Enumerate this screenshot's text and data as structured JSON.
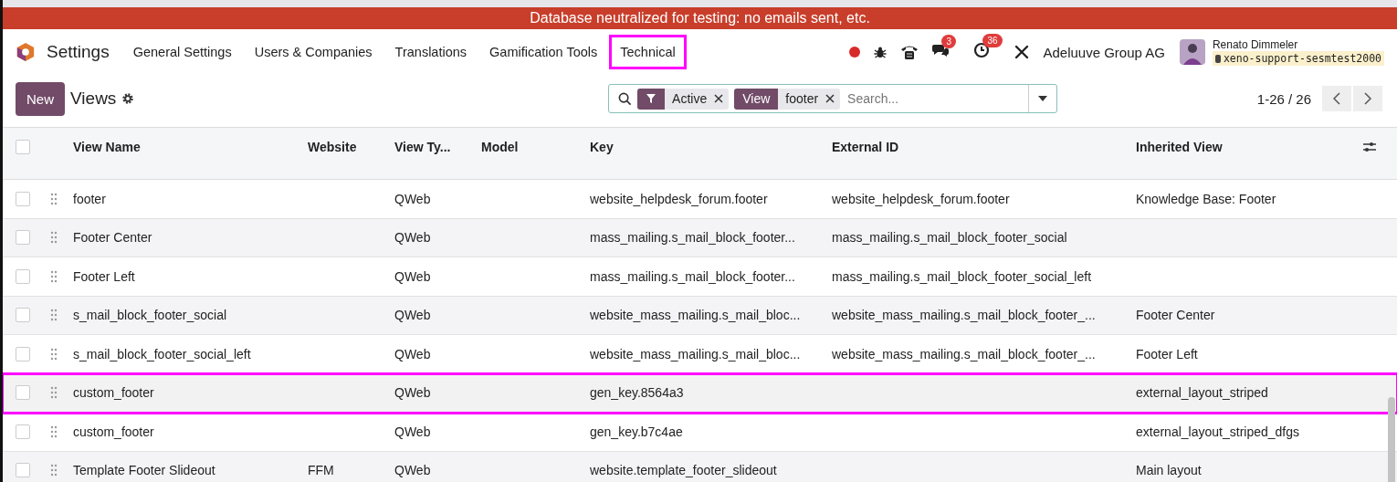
{
  "banner": {
    "text": "Database neutralized for testing: no emails sent, etc."
  },
  "nav": {
    "app": "Settings",
    "items": [
      {
        "label": "General Settings",
        "annotated": false
      },
      {
        "label": "Users & Companies",
        "annotated": false
      },
      {
        "label": "Translations",
        "annotated": false
      },
      {
        "label": "Gamification Tools",
        "annotated": false
      },
      {
        "label": "Technical",
        "annotated": true
      }
    ],
    "messages_badge": "3",
    "activities_badge": "36",
    "company": "Adeluuve Group AG",
    "user": "Renato Dimmeler",
    "database": "xeno-support-sesmtest2000"
  },
  "control_panel": {
    "new_button": "New",
    "title": "Views",
    "facets": [
      {
        "kind": "filter",
        "label": "Active"
      },
      {
        "kind": "field",
        "field": "View",
        "label": "footer"
      }
    ],
    "search_placeholder": "Search...",
    "pager": "1-26 / 26"
  },
  "table": {
    "all_checked": false,
    "columns": [
      "View Name",
      "Website",
      "View Ty...",
      "Model",
      "Key",
      "External ID",
      "Inherited View"
    ],
    "rows": [
      {
        "cells": [
          "footer",
          "",
          "QWeb",
          "",
          "website_helpdesk_forum.footer",
          "website_helpdesk_forum.footer",
          "Knowledge Base: Footer"
        ],
        "annotated": false,
        "checked": false
      },
      {
        "cells": [
          "Footer Center",
          "",
          "QWeb",
          "",
          "mass_mailing.s_mail_block_footer...",
          "mass_mailing.s_mail_block_footer_social",
          ""
        ],
        "annotated": false,
        "checked": false
      },
      {
        "cells": [
          "Footer Left",
          "",
          "QWeb",
          "",
          "mass_mailing.s_mail_block_footer...",
          "mass_mailing.s_mail_block_footer_social_left",
          ""
        ],
        "annotated": false,
        "checked": false
      },
      {
        "cells": [
          "s_mail_block_footer_social",
          "",
          "QWeb",
          "",
          "website_mass_mailing.s_mail_bloc...",
          "website_mass_mailing.s_mail_block_footer_...",
          "Footer Center"
        ],
        "annotated": false,
        "checked": false
      },
      {
        "cells": [
          "s_mail_block_footer_social_left",
          "",
          "QWeb",
          "",
          "website_mass_mailing.s_mail_bloc...",
          "website_mass_mailing.s_mail_block_footer_...",
          "Footer Left"
        ],
        "annotated": false,
        "checked": false
      },
      {
        "cells": [
          "custom_footer",
          "",
          "QWeb",
          "",
          "gen_key.8564a3",
          "",
          "external_layout_striped"
        ],
        "annotated": true,
        "checked": false
      },
      {
        "cells": [
          "custom_footer",
          "",
          "QWeb",
          "",
          "gen_key.b7c4ae",
          "",
          "external_layout_striped_dfgs"
        ],
        "annotated": false,
        "checked": false
      },
      {
        "cells": [
          "Template Footer Slideout",
          "FFM",
          "QWeb",
          "",
          "website.template_footer_slideout",
          "",
          "Main layout"
        ],
        "annotated": false,
        "checked": false
      }
    ]
  }
}
